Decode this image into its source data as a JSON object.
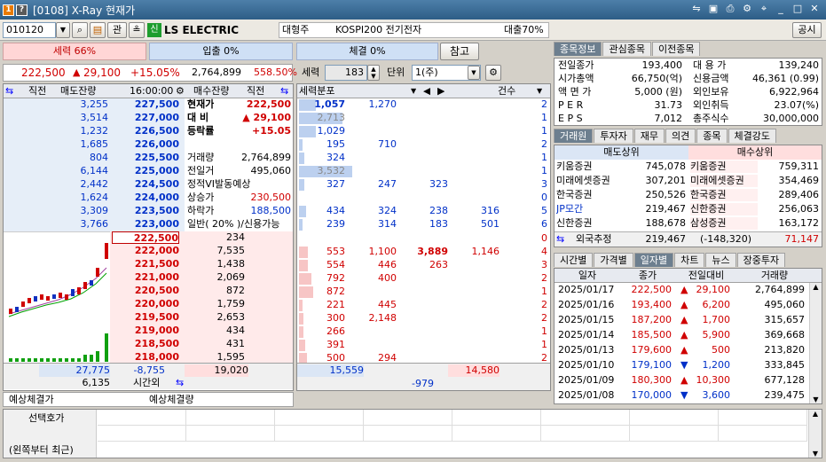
{
  "title": {
    "num1": "1",
    "num2": "?",
    "text": "[0108] X-Ray 현재가"
  },
  "toolbar": {
    "code": "010120",
    "btn_gwan": "관",
    "company_tag": "신",
    "company": "LS ELECTRIC",
    "sector_label": "대형주",
    "sector": "KOSPI200 전기전자",
    "loan": "대출70%",
    "notice": "공시"
  },
  "bars": {
    "force": "세력 66%",
    "buy": "입출 0%",
    "fill": "체결 0%",
    "ref": "참고"
  },
  "price_row": {
    "price": "222,500",
    "change": "29,100",
    "rate": "+15.05%",
    "volume": "2,764,899",
    "vol_rate": "558.50%"
  },
  "force_ctrl": {
    "label": "세력",
    "value": "183",
    "unit_label": "단위",
    "unit": "1(주)"
  },
  "ob_header": {
    "c1": "직전",
    "c2": "매도잔량",
    "time": "16:00:00",
    "c4": "매수잔량",
    "c5": "직전"
  },
  "asks": [
    {
      "qty": "3,255",
      "price": "227,500"
    },
    {
      "qty": "3,514",
      "price": "227,000"
    },
    {
      "qty": "1,232",
      "price": "226,500"
    },
    {
      "qty": "1,685",
      "price": "226,000"
    },
    {
      "qty": "804",
      "price": "225,500"
    },
    {
      "qty": "6,144",
      "price": "225,000"
    },
    {
      "qty": "2,442",
      "price": "224,500"
    },
    {
      "qty": "1,624",
      "price": "224,000"
    },
    {
      "qty": "3,309",
      "price": "223,500"
    },
    {
      "qty": "3,766",
      "price": "223,000"
    }
  ],
  "info": [
    {
      "label": "현재가",
      "value": "222,500"
    },
    {
      "label": "대 비",
      "value": "▲ 29,100"
    },
    {
      "label": "등락률",
      "value": "+15.05"
    },
    {
      "label": "",
      "value": ""
    },
    {
      "label": "거래량",
      "value": "2,764,899"
    },
    {
      "label": "전일거",
      "value": "495,060"
    },
    {
      "label": "정적VI발동예상",
      "value": ""
    },
    {
      "label": "상승가",
      "value": "230,500"
    },
    {
      "label": "하락가",
      "value": "188,500"
    },
    {
      "label": "일반( 20% )/신용가능",
      "value": ""
    }
  ],
  "bids": [
    {
      "price": "222,500",
      "qty": "234"
    },
    {
      "price": "222,000",
      "qty": "7,535"
    },
    {
      "price": "221,500",
      "qty": "1,438"
    },
    {
      "price": "221,000",
      "qty": "2,069"
    },
    {
      "price": "220,500",
      "qty": "872"
    },
    {
      "price": "220,000",
      "qty": "1,759"
    },
    {
      "price": "219,500",
      "qty": "2,653"
    },
    {
      "price": "219,000",
      "qty": "434"
    },
    {
      "price": "218,500",
      "qty": "431"
    },
    {
      "price": "218,000",
      "qty": "1,595"
    }
  ],
  "ob_totals": {
    "ask_total": "27,775",
    "diff": "-8,755",
    "bid_total": "19,020",
    "after_qty": "6,135",
    "after_label": "시간외"
  },
  "expect": {
    "l1": "예상체결가",
    "l2": "예상체결량"
  },
  "dist_header": {
    "title": "세력분포",
    "count": "건수"
  },
  "dist_rows": [
    {
      "v": [
        "1,057",
        "1,270",
        "",
        ""
      ],
      "cnt": "2"
    },
    {
      "v": [
        "2,713",
        "",
        "",
        ""
      ],
      "cnt": "1"
    },
    {
      "v": [
        "1,029",
        "",
        "",
        ""
      ],
      "cnt": "1"
    },
    {
      "v": [
        "195",
        "710",
        "",
        ""
      ],
      "cnt": "2"
    },
    {
      "v": [
        "324",
        "",
        "",
        ""
      ],
      "cnt": "1"
    },
    {
      "v": [
        "3,532",
        "",
        "",
        ""
      ],
      "cnt": "1"
    },
    {
      "v": [
        "327",
        "247",
        "323",
        ""
      ],
      "cnt": "3"
    },
    {
      "v": [
        "",
        "",
        "",
        ""
      ],
      "cnt": "0"
    },
    {
      "v": [
        "434",
        "324",
        "238",
        "316"
      ],
      "cnt": "5"
    },
    {
      "v": [
        "239",
        "314",
        "183",
        "501"
      ],
      "cnt": "6"
    },
    {
      "v": [
        "",
        "",
        "",
        ""
      ],
      "cnt": "0"
    },
    {
      "v": [
        "553",
        "1,100",
        "3,889",
        "1,146"
      ],
      "cnt": "4"
    },
    {
      "v": [
        "554",
        "446",
        "263",
        ""
      ],
      "cnt": "3"
    },
    {
      "v": [
        "792",
        "400",
        "",
        ""
      ],
      "cnt": "2"
    },
    {
      "v": [
        "872",
        "",
        "",
        ""
      ],
      "cnt": "1"
    },
    {
      "v": [
        "221",
        "445",
        "",
        ""
      ],
      "cnt": "2"
    },
    {
      "v": [
        "300",
        "2,148",
        "",
        ""
      ],
      "cnt": "2"
    },
    {
      "v": [
        "266",
        "",
        "",
        ""
      ],
      "cnt": "1"
    },
    {
      "v": [
        "391",
        "",
        "",
        ""
      ],
      "cnt": "1"
    },
    {
      "v": [
        "500",
        "294",
        "",
        ""
      ],
      "cnt": "2"
    }
  ],
  "dist_totals": {
    "ask": "15,559",
    "bid": "14,580",
    "diff": "-979"
  },
  "stock_tabs": [
    "종목정보",
    "관심종목",
    "이전종목"
  ],
  "stock_info": [
    {
      "l": "전일종가",
      "v": "193,400",
      "l2": "대 용 가",
      "v2": "139,240"
    },
    {
      "l": "시가총액",
      "v": "66,750(억)",
      "l2": "신용금액",
      "v2": "46,361  (0.99)"
    },
    {
      "l": "액 면 가",
      "v": "5,000 (원)",
      "l2": "외인보유",
      "v2": "6,922,964"
    },
    {
      "l": "P E R",
      "v": "31.73",
      "l2": "외인취득",
      "v2": "23.07(%)"
    },
    {
      "l": "E P S",
      "v": "7,012",
      "l2": "총주식수",
      "v2": "30,000,000"
    }
  ],
  "broker_tabs": [
    "거래원",
    "투자자",
    "재무",
    "의견",
    "종목",
    "체결강도"
  ],
  "broker_hdr": {
    "sell": "매도상위",
    "buy": "매수상위"
  },
  "brokers": [
    {
      "s": "키움증권",
      "sv": "745,078",
      "b": "키움증권",
      "bv": "759,311"
    },
    {
      "s": "미래에셋증권",
      "sv": "307,201",
      "b": "미래에셋증권",
      "bv": "354,469"
    },
    {
      "s": "한국증권",
      "sv": "250,526",
      "b": "한국증권",
      "bv": "289,406"
    },
    {
      "s": "JP모간",
      "sv": "219,467",
      "b": "신한증권",
      "bv": "256,063"
    },
    {
      "s": "신한증권",
      "sv": "188,678",
      "b": "삼성증권",
      "bv": "163,172"
    }
  ],
  "foreign": {
    "label": "외국추정",
    "sv": "219,467",
    "diff": "(-148,320)",
    "bv": "71,147"
  },
  "daily_tabs": [
    "시간별",
    "가격별",
    "일자별",
    "차트",
    "뉴스",
    "장중투자"
  ],
  "daily_hdr": [
    "일자",
    "종가",
    "전일대비",
    "거래량"
  ],
  "daily": [
    {
      "d": "2025/01/17",
      "c": "222,500",
      "dir": "▲",
      "chg": "29,100",
      "vol": "2,764,899"
    },
    {
      "d": "2025/01/16",
      "c": "193,400",
      "dir": "▲",
      "chg": "6,200",
      "vol": "495,060"
    },
    {
      "d": "2025/01/15",
      "c": "187,200",
      "dir": "▲",
      "chg": "1,700",
      "vol": "315,657"
    },
    {
      "d": "2025/01/14",
      "c": "185,500",
      "dir": "▲",
      "chg": "5,900",
      "vol": "369,668"
    },
    {
      "d": "2025/01/13",
      "c": "179,600",
      "dir": "▲",
      "chg": "500",
      "vol": "213,820"
    },
    {
      "d": "2025/01/10",
      "c": "179,100",
      "dir": "▼",
      "chg": "1,200",
      "vol": "333,845"
    },
    {
      "d": "2025/01/09",
      "c": "180,300",
      "dir": "▲",
      "chg": "10,300",
      "vol": "677,128"
    },
    {
      "d": "2025/01/08",
      "c": "170,000",
      "dir": "▼",
      "chg": "3,600",
      "vol": "239,475"
    }
  ],
  "bottom": {
    "l1": "선택호가",
    "l2": "(왼쪽부터 최근)"
  }
}
